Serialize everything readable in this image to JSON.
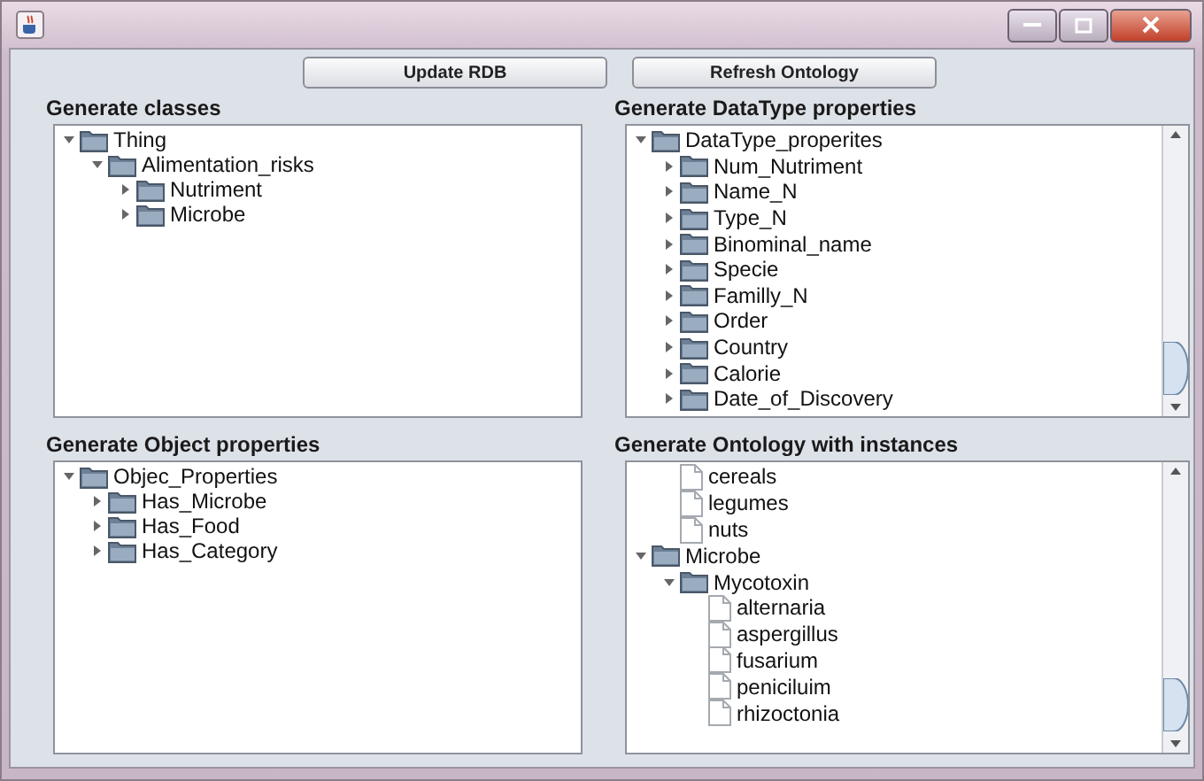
{
  "buttons": [
    "Update RDB",
    "Refresh Ontology"
  ],
  "panels": [
    {
      "heading": "Generate classes",
      "scrollbar": false,
      "nodes": [
        {
          "label": "Thing",
          "kind": "folder",
          "expanded": true,
          "children": [
            {
              "label": "Alimentation_risks",
              "kind": "folder",
              "expanded": true,
              "children": [
                {
                  "label": "Nutriment",
                  "kind": "folder",
                  "expanded": false
                },
                {
                  "label": "Microbe",
                  "kind": "folder",
                  "expanded": false
                }
              ]
            }
          ]
        }
      ]
    },
    {
      "heading": "Generate DataType properties",
      "scrollbar": true,
      "nodes": [
        {
          "label": "DataType_properites",
          "kind": "folder",
          "expanded": true,
          "children": [
            {
              "label": "Num_Nutriment",
              "kind": "folder",
              "expanded": false
            },
            {
              "label": "Name_N",
              "kind": "folder",
              "expanded": false
            },
            {
              "label": "Type_N",
              "kind": "folder",
              "expanded": false
            },
            {
              "label": "Binominal_name",
              "kind": "folder",
              "expanded": false
            },
            {
              "label": "Specie",
              "kind": "folder",
              "expanded": false
            },
            {
              "label": "Familly_N",
              "kind": "folder",
              "expanded": false
            },
            {
              "label": "Order",
              "kind": "folder",
              "expanded": false
            },
            {
              "label": "Country",
              "kind": "folder",
              "expanded": false
            },
            {
              "label": "Calorie",
              "kind": "folder",
              "expanded": false
            },
            {
              "label": "Date_of_Discovery",
              "kind": "folder",
              "expanded": false
            }
          ]
        }
      ]
    },
    {
      "heading": "Generate Object properties",
      "scrollbar": false,
      "nodes": [
        {
          "label": "Objec_Properties",
          "kind": "folder",
          "expanded": true,
          "children": [
            {
              "label": "Has_Microbe",
              "kind": "folder",
              "expanded": false
            },
            {
              "label": "Has_Food",
              "kind": "folder",
              "expanded": false
            },
            {
              "label": "Has_Category",
              "kind": "folder",
              "expanded": false
            }
          ]
        }
      ]
    },
    {
      "heading": "Generate Ontology with instances",
      "scrollbar": true,
      "nodes": [
        {
          "children": [
            {
              "label": "cereals",
              "kind": "leaf"
            },
            {
              "label": "legumes",
              "kind": "leaf"
            },
            {
              "label": "nuts",
              "kind": "leaf"
            }
          ]
        },
        {
          "label": "Microbe",
          "kind": "folder",
          "expanded": true,
          "children": [
            {
              "label": "Mycotoxin",
              "kind": "folder",
              "expanded": true,
              "children": [
                {
                  "label": "alternaria",
                  "kind": "leaf"
                },
                {
                  "label": "aspergillus",
                  "kind": "leaf"
                },
                {
                  "label": "fusarium",
                  "kind": "leaf"
                },
                {
                  "label": "peniciluim",
                  "kind": "leaf"
                },
                {
                  "label": "rhizoctonia",
                  "kind": "leaf"
                }
              ]
            }
          ]
        }
      ]
    }
  ]
}
